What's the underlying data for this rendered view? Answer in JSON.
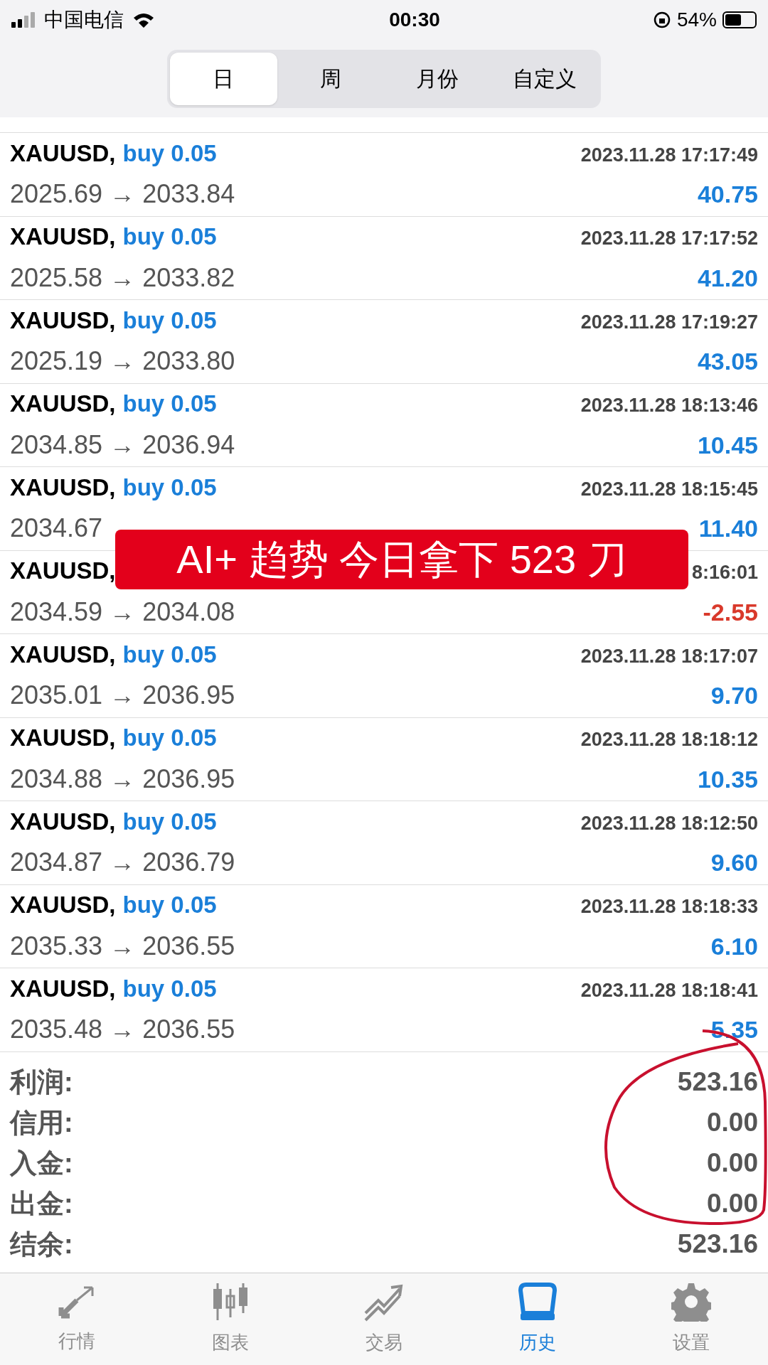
{
  "status_bar": {
    "carrier": "中国电信",
    "time": "00:30",
    "battery": "54%"
  },
  "period_tabs": [
    {
      "label": "日",
      "selected": true
    },
    {
      "label": "周",
      "selected": false
    },
    {
      "label": "月份",
      "selected": false
    },
    {
      "label": "自定义",
      "selected": false
    }
  ],
  "trades": [
    {
      "symbol": "XAUUSD,",
      "side": "buy 0.05",
      "time": "2023.11.28 17:17:49",
      "open": "2025.69",
      "arrow": "→",
      "close": "2033.84",
      "profit": "40.75",
      "kind": "gain"
    },
    {
      "symbol": "XAUUSD,",
      "side": "buy 0.05",
      "time": "2023.11.28 17:17:52",
      "open": "2025.58",
      "arrow": "→",
      "close": "2033.82",
      "profit": "41.20",
      "kind": "gain"
    },
    {
      "symbol": "XAUUSD,",
      "side": "buy 0.05",
      "time": "2023.11.28 17:19:27",
      "open": "2025.19",
      "arrow": "→",
      "close": "2033.80",
      "profit": "43.05",
      "kind": "gain"
    },
    {
      "symbol": "XAUUSD,",
      "side": "buy 0.05",
      "time": "2023.11.28 18:13:46",
      "open": "2034.85",
      "arrow": "→",
      "close": "2036.94",
      "profit": "10.45",
      "kind": "gain"
    },
    {
      "symbol": "XAUUSD,",
      "side": "buy 0.05",
      "time": "2023.11.28 18:15:45",
      "open": "2034.67",
      "profit": "11.40",
      "kind": "gain"
    },
    {
      "symbol": "XAUUSD,",
      "time": "8:16:01",
      "open": "2034.59",
      "arrow": "→",
      "close": "2034.08",
      "profit": "-2.55",
      "kind": "loss"
    },
    {
      "symbol": "XAUUSD,",
      "side": "buy 0.05",
      "time": "2023.11.28 18:17:07",
      "open": "2035.01",
      "arrow": "→",
      "close": "2036.95",
      "profit": "9.70",
      "kind": "gain"
    },
    {
      "symbol": "XAUUSD,",
      "side": "buy 0.05",
      "time": "2023.11.28 18:18:12",
      "open": "2034.88",
      "arrow": "→",
      "close": "2036.95",
      "profit": "10.35",
      "kind": "gain"
    },
    {
      "symbol": "XAUUSD,",
      "side": "buy 0.05",
      "time": "2023.11.28 18:12:50",
      "open": "2034.87",
      "arrow": "→",
      "close": "2036.79",
      "profit": "9.60",
      "kind": "gain"
    },
    {
      "symbol": "XAUUSD,",
      "side": "buy 0.05",
      "time": "2023.11.28 18:18:33",
      "open": "2035.33",
      "arrow": "→",
      "close": "2036.55",
      "profit": "6.10",
      "kind": "gain"
    },
    {
      "symbol": "XAUUSD,",
      "side": "buy 0.05",
      "time": "2023.11.28 18:18:41",
      "open": "2035.48",
      "arrow": "→",
      "close": "2036.55",
      "profit": "5.35",
      "kind": "gain"
    }
  ],
  "summary": [
    {
      "label": "利润:",
      "value": "523.16"
    },
    {
      "label": "信用:",
      "value": "0.00"
    },
    {
      "label": "入金:",
      "value": "0.00"
    },
    {
      "label": "出金:",
      "value": "0.00"
    },
    {
      "label": "结余:",
      "value": "523.16"
    }
  ],
  "banner": {
    "text": "AI+ 趋势 今日拿下 523 刀"
  },
  "bottom_tabs": [
    {
      "label": "行情",
      "kind": "quotes",
      "selected": false
    },
    {
      "label": "图表",
      "kind": "chart",
      "selected": false
    },
    {
      "label": "交易",
      "kind": "trade",
      "selected": false
    },
    {
      "label": "历史",
      "kind": "history",
      "selected": true
    },
    {
      "label": "设置",
      "kind": "settings",
      "selected": false
    }
  ]
}
